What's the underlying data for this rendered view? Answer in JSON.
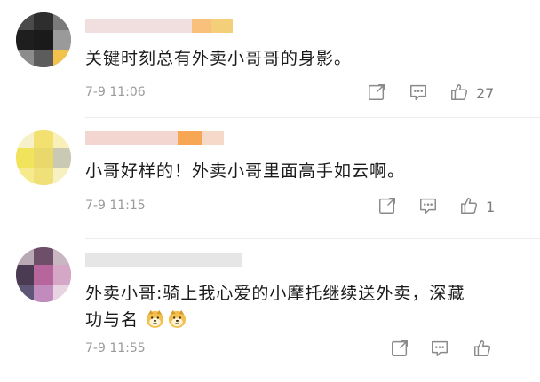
{
  "comments": [
    {
      "text": "关键时刻总有外卖小哥哥的身影。",
      "time": "7-9 11:06",
      "like_count": "27",
      "emojis": []
    },
    {
      "text": "小哥好样的！外卖小哥里面高手如云啊。",
      "time": "7-9 11:15",
      "like_count": "1",
      "emojis": []
    },
    {
      "text_line1": "外卖小哥:骑上我心爱的小摩托继续送外卖，深藏",
      "text_line2": "功与名",
      "time": "7-9 11:55",
      "like_count": "",
      "emojis": [
        "doge-emoji",
        "doge-emoji"
      ]
    }
  ],
  "icons": {
    "share": "share-icon",
    "reply": "comment-icon",
    "like": "thumbs-up-icon"
  },
  "colors": {
    "text": "#1a1a1a",
    "meta": "#9a9a9a",
    "icon": "#8a8a8a",
    "divider": "#ececec"
  }
}
